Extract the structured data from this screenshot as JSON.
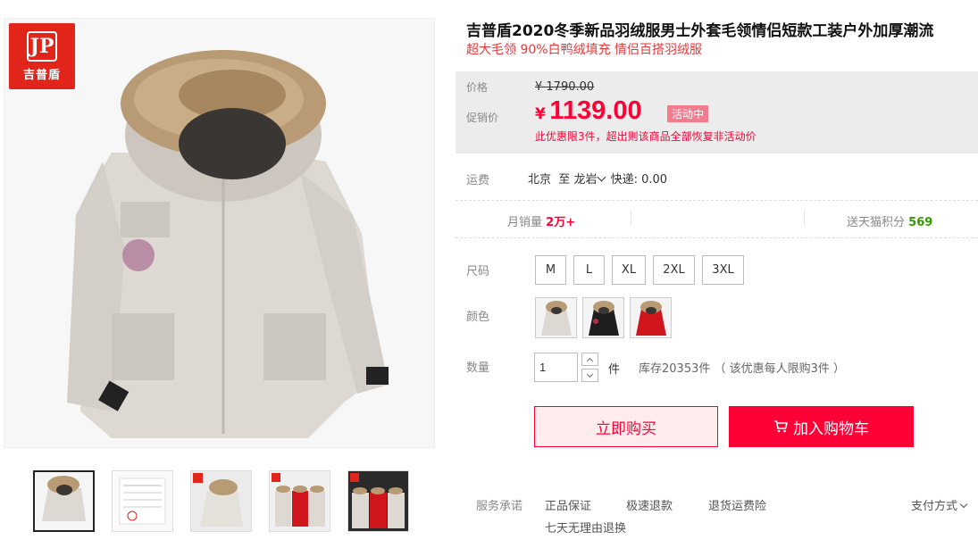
{
  "brand": {
    "logo_text": "吉普盾",
    "logo_mark": "JP"
  },
  "product": {
    "title": "吉普盾2020冬季新品羽绒服男士外套毛领情侣短款工装户外加厚潮流",
    "subtitle": "超大毛领 90%白鸭绒填充 情侣百搭羽绒服"
  },
  "price": {
    "label": "价格",
    "original": "¥ 1790.00",
    "promo_label": "促销价",
    "currency": "¥",
    "promo": "1139.00",
    "badge": "活动中",
    "note": "此优惠限3件，超出则该商品全部恢复非活动价"
  },
  "shipping": {
    "label": "运费",
    "from": "北京",
    "to_word": "至",
    "destination": "龙岩",
    "express": "快递: 0.00"
  },
  "stats": {
    "monthly_sales_label": "月销量",
    "monthly_sales": "2万+",
    "points_label": "送天猫积分",
    "points": "569"
  },
  "options": {
    "size_label": "尺码",
    "sizes": [
      "M",
      "L",
      "XL",
      "2XL",
      "3XL"
    ],
    "color_label": "颜色",
    "colors": [
      "beige",
      "black",
      "red"
    ]
  },
  "quantity": {
    "label": "数量",
    "value": "1",
    "unit": "件",
    "stock": "库存20353件 （ 该优惠每人限购3件 ）"
  },
  "actions": {
    "buy_now": "立即购买",
    "add_cart": "加入购物车"
  },
  "services": {
    "label": "服务承诺",
    "items": [
      "正品保证",
      "极速退款",
      "退货运费险",
      "七天无理由退换"
    ],
    "payment": "支付方式"
  },
  "colors_theme": {
    "accent": "#ff0036",
    "brand_red": "#e1251b",
    "points_green": "#339900"
  }
}
